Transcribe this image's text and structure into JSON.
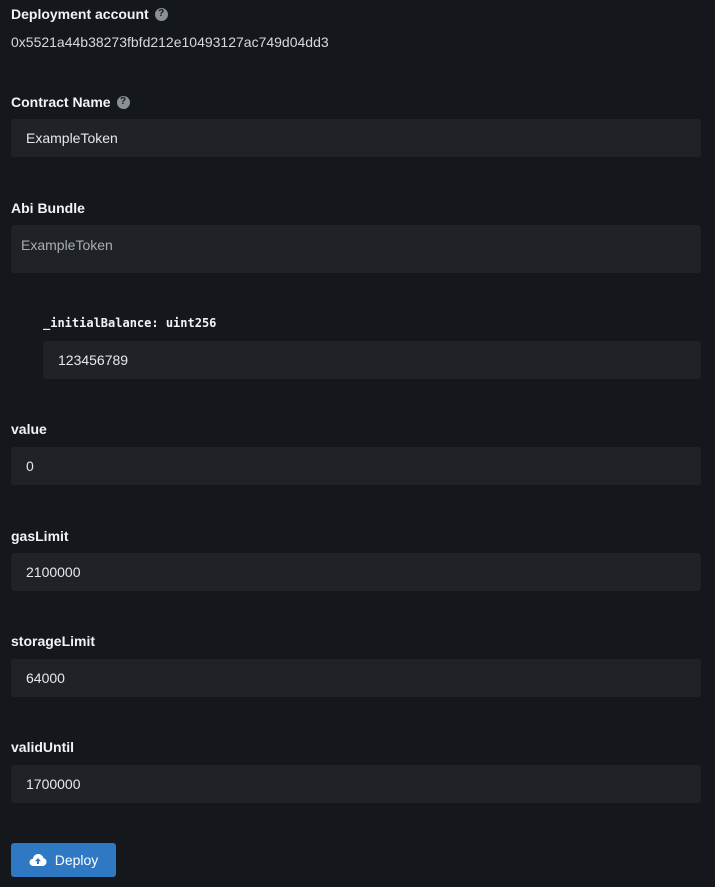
{
  "deployment_account": {
    "label": "Deployment account",
    "address": "0x5521a44b38273fbfd212e10493127ac749d04dd3"
  },
  "contract_name": {
    "label": "Contract Name",
    "value": "ExampleToken"
  },
  "abi_bundle": {
    "label": "Abi Bundle",
    "value": "ExampleToken"
  },
  "constructor_param": {
    "label": "_initialBalance: uint256",
    "value": "123456789"
  },
  "value_field": {
    "label": "value",
    "value": "0"
  },
  "gas_limit": {
    "label": "gasLimit",
    "value": "2100000"
  },
  "storage_limit": {
    "label": "storageLimit",
    "value": "64000"
  },
  "valid_until": {
    "label": "validUntil",
    "value": "1700000"
  },
  "deploy_button": {
    "label": "Deploy",
    "icon": "cloud-upload-icon",
    "color": "#2f78c4"
  },
  "help_icon_glyph": "?"
}
